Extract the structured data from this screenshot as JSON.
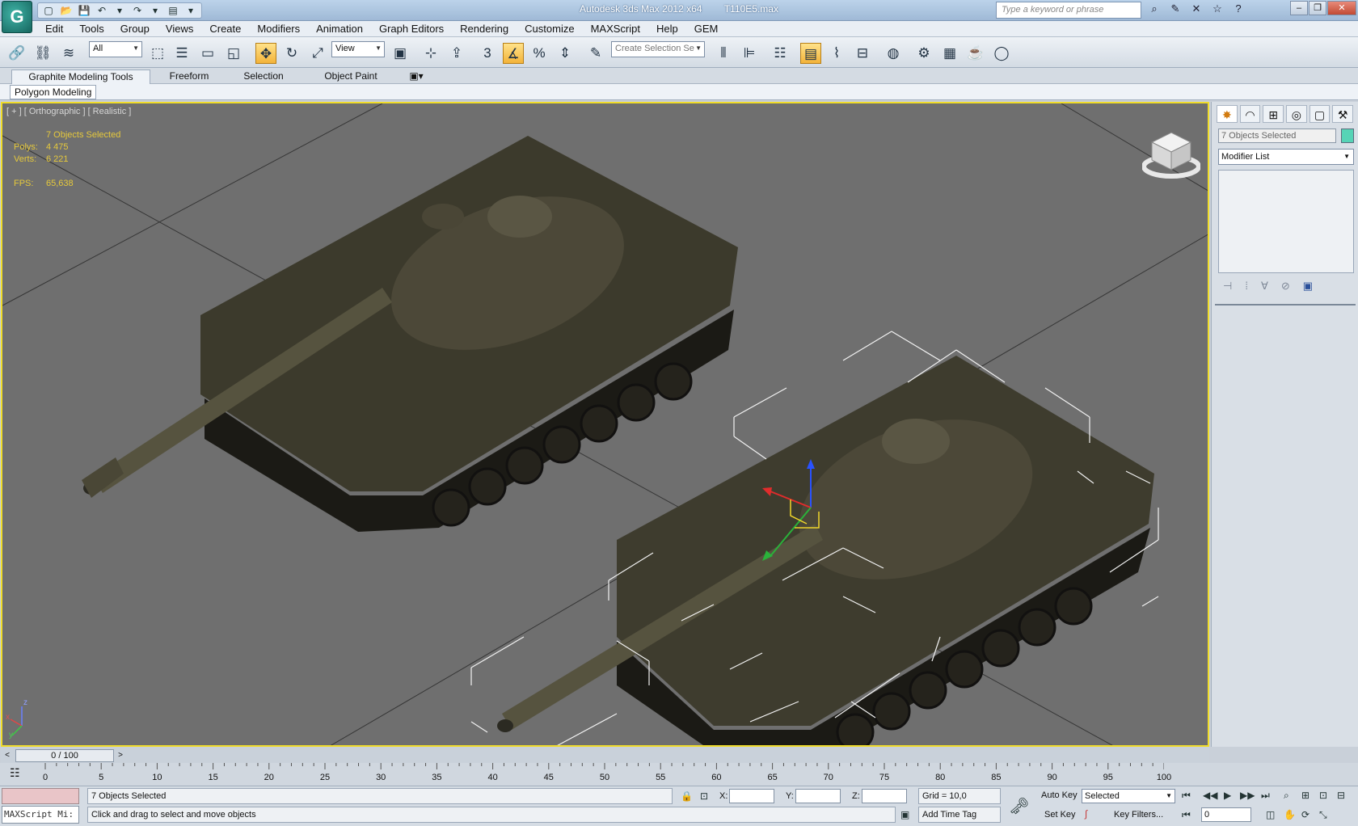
{
  "app": {
    "logo_glyph": "G",
    "title_parts": [
      "Autodesk 3ds Max 2012 x64",
      "T110E5.max"
    ],
    "search_placeholder": "Type a keyword or phrase"
  },
  "menu": [
    "Edit",
    "Tools",
    "Group",
    "Views",
    "Create",
    "Modifiers",
    "Animation",
    "Graph Editors",
    "Rendering",
    "Customize",
    "MAXScript",
    "Help",
    "GEM"
  ],
  "toolbar": {
    "filter_value": "All",
    "refcoord_value": "View",
    "selection_set_placeholder": "Create Selection Se",
    "snap_value": "3"
  },
  "ribbon": {
    "tabs": [
      "Graphite Modeling Tools",
      "Freeform",
      "Selection",
      "Object Paint"
    ],
    "panel_button": "Polygon Modeling"
  },
  "viewport": {
    "label": "[ + ] [ Orthographic ] [ Realistic ]",
    "selected_text": "7 Objects Selected",
    "polys_label": "Polys:",
    "polys_value": "4 475",
    "verts_label": "Verts:",
    "verts_value": "6 221",
    "fps_label": "FPS:",
    "fps_value": "65,638",
    "axis_z": "z",
    "axis_x": "x",
    "axis_y": "y"
  },
  "command_panel": {
    "object_name": "7 Objects Selected",
    "object_color": "#56d4b6",
    "modifier_list": "Modifier List"
  },
  "timeline": {
    "slider_text": "0 / 100",
    "ticks": [
      "0",
      "5",
      "10",
      "15",
      "20",
      "25",
      "30",
      "35",
      "40",
      "45",
      "50",
      "55",
      "60",
      "65",
      "70",
      "75",
      "80",
      "85",
      "90",
      "95",
      "100"
    ]
  },
  "status": {
    "maxscript": "MAXScript Mi:",
    "selected": "7 Objects Selected",
    "prompt": "Click and drag to select and move objects",
    "x_label": "X:",
    "y_label": "Y:",
    "z_label": "Z:",
    "grid": "Grid = 10,0",
    "add_time_tag": "Add Time Tag",
    "auto_key": "Auto Key",
    "set_key": "Set Key",
    "selected_dd": "Selected",
    "key_filters": "Key Filters...",
    "frame": "0"
  },
  "colors": {
    "viewport_bg": "#6f6f6f",
    "active_border": "#f0dc2a",
    "stats_text": "#e6c93c"
  }
}
